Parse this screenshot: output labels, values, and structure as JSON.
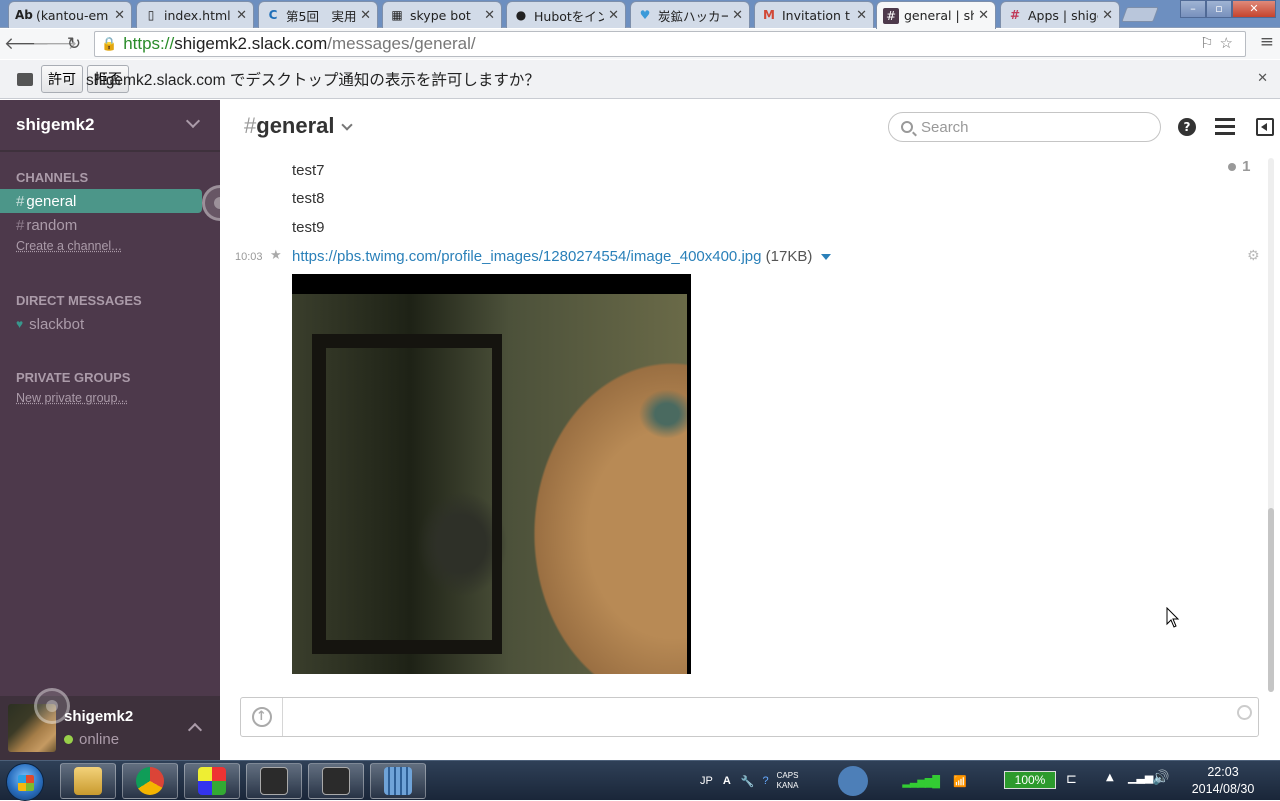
{
  "browser": {
    "tabs": [
      {
        "title": "(kantou-em",
        "icon": "ab-icon"
      },
      {
        "title": "index.html",
        "icon": "document-icon"
      },
      {
        "title": "第5回　実用",
        "icon": "c-icon"
      },
      {
        "title": "skype bot",
        "icon": "grid-icon"
      },
      {
        "title": "Hubotをイン",
        "icon": "github-icon"
      },
      {
        "title": "炭鉱ハッカー",
        "icon": "twitter-icon"
      },
      {
        "title": "Invitation t",
        "icon": "gmail-icon"
      },
      {
        "title": "general | sh",
        "icon": "slack-hash-icon"
      },
      {
        "title": "Apps | shige",
        "icon": "slack-icon"
      }
    ],
    "url": {
      "scheme": "https://",
      "host": "shigemk2.slack.com",
      "path": "/messages/general/"
    },
    "infobar": {
      "message": "shigemk2.slack.com でデスクトップ通知の表示を許可しますか？",
      "allow": "許可",
      "deny": "拒否"
    }
  },
  "sidebar": {
    "team_name": "shigemk2",
    "channels_header": "CHANNELS",
    "channels": [
      {
        "name": "general",
        "active": true
      },
      {
        "name": "random",
        "active": false
      }
    ],
    "create_channel": "Create a channel...",
    "dm_header": "DIRECT MESSAGES",
    "dms": [
      {
        "name": "slackbot"
      }
    ],
    "private_header": "PRIVATE GROUPS",
    "new_private": "New private group...",
    "user": {
      "name": "shigemk2",
      "status": "online"
    }
  },
  "channel": {
    "hash": "#",
    "name": "general",
    "search_placeholder": "Search",
    "members_count": "1",
    "messages": [
      "test7",
      "test8",
      "test9"
    ],
    "file_message": {
      "time": "10:03",
      "url": "https://pbs.twimg.com/profile_images/1280274554/image_400x400.jpg",
      "size": "(17KB)"
    }
  },
  "taskbar": {
    "ime": "JP",
    "caps": "CAPS",
    "kana": "KANA",
    "battery": "100%",
    "time": "22:03",
    "date": "2014/08/30"
  },
  "colors": {
    "sidebar": "#4d394b",
    "active_channel": "#4c9689",
    "link": "#2a80b9",
    "online": "#99d04a"
  }
}
